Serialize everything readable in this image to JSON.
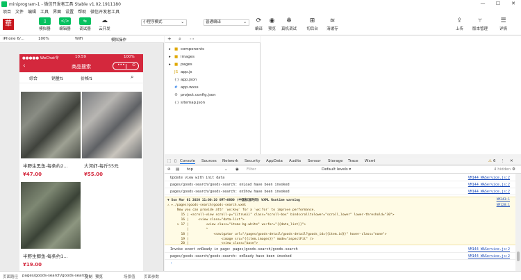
{
  "window": {
    "title": "miniprogram-1 - 微信开发者工具 Stable v1.02.1911180",
    "min": "—",
    "max": "☐",
    "close": "✕"
  },
  "menu": [
    "项目",
    "文件",
    "编辑",
    "工具",
    "界面",
    "设置",
    "帮助",
    "微信开发者工具"
  ],
  "toolbar": {
    "avatar_char": "華",
    "simulator": "模拟器",
    "editor": "编辑器",
    "debugger": "调试器",
    "cloud": "云开发",
    "mode_select": "小程序模式",
    "compile_select": "普通编译",
    "compile": "编译",
    "preview": "预览",
    "real_debug": "真机调试",
    "background": "切后台",
    "clear_cache": "清缓存",
    "upload": "上传",
    "version": "版本管理",
    "details": "详情"
  },
  "sim_top": {
    "device": "iPhone 6/...",
    "zoom": "100%",
    "network": "WiFi",
    "operation": "模拟操作"
  },
  "phone": {
    "carrier": "●●●●● WeChat令",
    "time": "10:59",
    "battery": "100%",
    "nav_title": "商品搜索",
    "capsule_dots": "•••",
    "capsule_close": "⊙",
    "sort": [
      "综合",
      "销量⇅",
      "价格⇅"
    ],
    "products": [
      {
        "name": "半野生黑鱼-每条约2...",
        "price": "¥47.00"
      },
      {
        "name": "大河虾-每斤55元",
        "price": "¥55.00"
      },
      {
        "name": "半野生鲫鱼-每条约1...",
        "price": "¥19.00"
      }
    ]
  },
  "tree": {
    "items": [
      {
        "name": "components",
        "type": "folder"
      },
      {
        "name": "images",
        "type": "folder"
      },
      {
        "name": "pages",
        "type": "folder"
      },
      {
        "name": "app.js",
        "type": "js"
      },
      {
        "name": "app.json",
        "type": "json"
      },
      {
        "name": "app.wxss",
        "type": "wxss"
      },
      {
        "name": "project.config.json",
        "type": "json"
      },
      {
        "name": "sitemap.json",
        "type": "json"
      }
    ]
  },
  "devtools": {
    "tabs": [
      "Console",
      "Sources",
      "Network",
      "Security",
      "AppData",
      "Audits",
      "Sensor",
      "Storage",
      "Trace",
      "Wxml"
    ],
    "warn_count": "6",
    "context": "top",
    "filter_placeholder": "Filter",
    "levels": "Default levels ▾",
    "hidden": "4 hidden"
  },
  "console": {
    "lines": [
      {
        "text": "Update view with init data",
        "src": "VM144 WAService.js:2"
      },
      {
        "text": "pages/goods-search/goods-search: onLoad have been invoked",
        "src": "VM144 WAService.js:2"
      },
      {
        "text": "pages/goods-search/goods-search: onShow have been invoked",
        "src": "VM144 WAService.js:2"
      }
    ],
    "warning": {
      "header": "▼ Sun Mar 01 2020 11:00:10 GMT+0800 (中国标准时间) WXML Runtime warning",
      "header_src": "VM243:1",
      "file": "⚠ ▸./pages/goods-search/goods-search.wxml",
      "file_src": "VM128:1",
      "body": [
        "Now you can provide attr `wx:key` for a `wx:for` to improve performance.",
        "  15 | <scroll-view scroll-y=\"{{true}}\" class=\"scroll-box\" bindscrolltolower=\"scroll_lower\" lower-threshold=\"30\">",
        "  16 |     <view class=\"data-list\">",
        "> 17 |         <view class=\"items bg-white\" wx:for=\"{{data_list}}\">",
        "     |         ^",
        "  18 |             <navigator url=\"/pages/goods-detail/goods-detail?goods_id={{item.id}}\" hover-class=\"none\">",
        "  19 |                 <image src=\"{{item.images}}\" mode=\"aspectFit\" />",
        "  20 |                 <view class=\"base\">"
      ]
    },
    "after": [
      {
        "text": "Invoke event onReady in page: pages/goods-search/goods-search",
        "src": "VM144 WAService.js:2"
      },
      {
        "text": "pages/goods-search/goods-search: onReady have been invoked",
        "src": "VM144 WAService.js:2"
      }
    ],
    "prompt": "›"
  },
  "statusbar": {
    "path_label": "页面路径",
    "path": "pages/goods-search/goods-search",
    "copy": "复制",
    "preview": "预览",
    "scene": "场景值",
    "params": "页面参数"
  }
}
